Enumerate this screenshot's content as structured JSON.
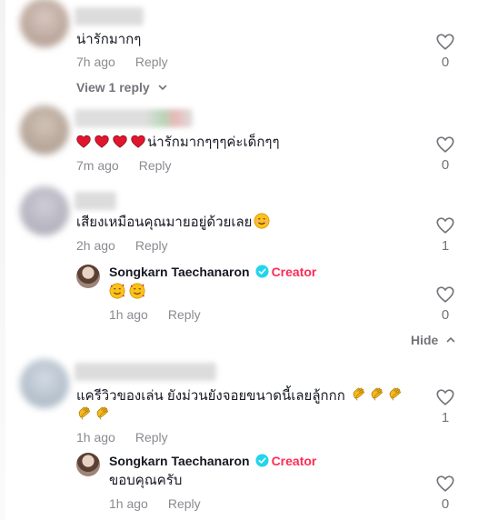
{
  "comments": [
    {
      "text": "น่ารักมากๆ",
      "time": "7h ago",
      "reply_label": "Reply",
      "likes": "0",
      "view_replies": "View 1 reply"
    },
    {
      "text": "น่ารักมากๆๆๆค่ะเด็กๆๆ",
      "emoji": [
        "red-heart",
        "red-heart",
        "red-heart",
        "red-heart"
      ],
      "time": "7m ago",
      "reply_label": "Reply",
      "likes": "0"
    },
    {
      "text": "เสียงเหมือนคุณมายอยู่ด้วยเลย",
      "emoji": [
        "smiling-face"
      ],
      "time": "2h ago",
      "reply_label": "Reply",
      "likes": "1",
      "reply": {
        "author": "Songkarn Taechanaron",
        "creator_label": "Creator",
        "emoji": [
          "smiling-face-with-hearts",
          "smiling-face-with-hearts"
        ],
        "time": "1h ago",
        "reply_label": "Reply",
        "likes": "0"
      },
      "hide_label": "Hide"
    },
    {
      "text": "แครีวิวของเล่น ยังม่วนยังจอยขนาดนี้เลยลู้กกก",
      "emoji": [
        "clapping-hands",
        "clapping-hands",
        "clapping-hands",
        "clapping-hands",
        "clapping-hands"
      ],
      "time": "1h ago",
      "reply_label": "Reply",
      "likes": "1",
      "reply": {
        "author": "Songkarn Taechanaron",
        "creator_label": "Creator",
        "text": "ขอบคุณครับ",
        "time": "1h ago",
        "reply_label": "Reply",
        "likes": "0"
      }
    }
  ],
  "colors": {
    "creator": "#fe2c55",
    "verified": "#20d5ec",
    "meta": "#8a8b91",
    "heart_outline": "#73747b"
  }
}
